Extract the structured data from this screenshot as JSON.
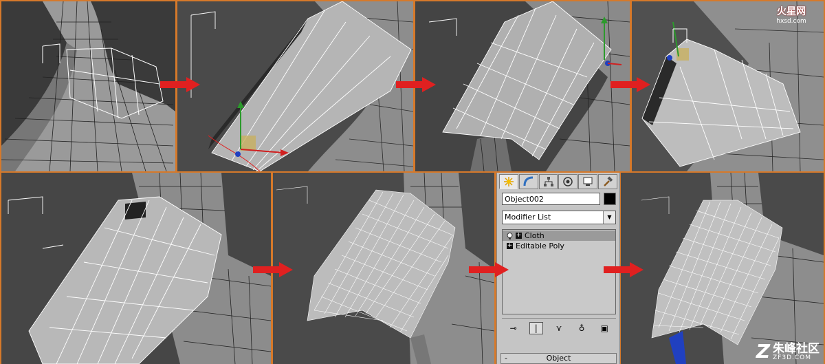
{
  "command_panel": {
    "tabs": [
      "create-icon",
      "modify-icon",
      "hierarchy-icon",
      "motion-icon",
      "display-icon",
      "utilities-icon"
    ],
    "object_name": "Object002",
    "object_color": "#000000",
    "modifier_list_label": "Modifier List",
    "stack": [
      {
        "label": "Cloth",
        "selected": true
      },
      {
        "label": "Editable Poly",
        "selected": false
      }
    ],
    "rollout_minus": "-",
    "rollout_label": "Object"
  },
  "watermark_top": {
    "title": "火星网",
    "url": "hxsd.com"
  },
  "watermark_bottom": {
    "title": "朱峰社区",
    "url": "ZF3D.COM"
  },
  "colors": {
    "border": "#d6792a",
    "arrow": "#e02020",
    "viewport_bg": "#2e2e2e",
    "panel_bg": "#c5c5c5"
  }
}
